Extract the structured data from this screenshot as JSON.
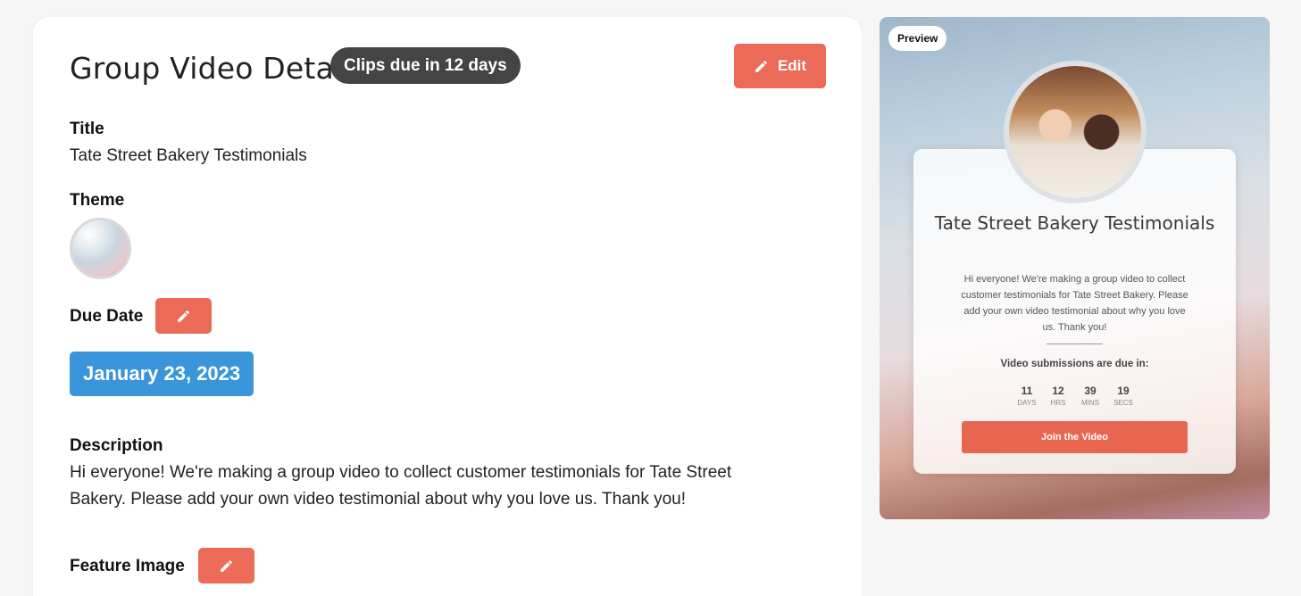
{
  "details": {
    "page_title": "Group Video Details",
    "due_badge": "Clips due in 12 days",
    "edit_label": "Edit",
    "title_label": "Title",
    "title_value": "Tate Street Bakery Testimonials",
    "theme_label": "Theme",
    "due_date_label": "Due Date",
    "due_date_value": "January 23, 2023",
    "description_label": "Description",
    "description_value": "Hi everyone! We're making a group video to collect customer testimonials for Tate Street Bakery. Please add your own video testimonial about why you love us. Thank you!",
    "feature_image_label": "Feature Image"
  },
  "preview": {
    "tag": "Preview",
    "title": "Tate Street Bakery Testimonials",
    "description": "Hi everyone! We're making a group video to collect customer testimonials for Tate Street Bakery. Please add your own video testimonial about why you love us. Thank you!",
    "due_text": "Video submissions are due in:",
    "countdown": [
      {
        "value": "11",
        "unit": "DAYS"
      },
      {
        "value": "12",
        "unit": "HRS"
      },
      {
        "value": "39",
        "unit": "MINS"
      },
      {
        "value": "19",
        "unit": "SECS"
      }
    ],
    "join_label": "Join the Video"
  },
  "colors": {
    "accent": "#ec6a58",
    "date_pill": "#3a95db",
    "badge": "#444444"
  },
  "icons": {
    "edit": "pencil-icon"
  }
}
